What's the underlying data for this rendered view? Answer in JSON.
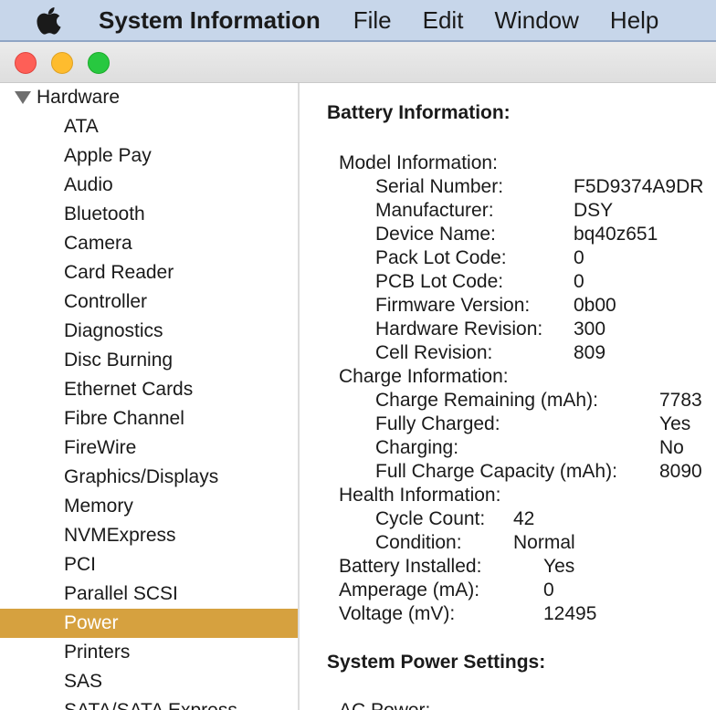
{
  "menubar": {
    "app_name": "System Information",
    "items": [
      "File",
      "Edit",
      "Window",
      "Help"
    ]
  },
  "sidebar": {
    "group_label": "Hardware",
    "items": [
      "ATA",
      "Apple Pay",
      "Audio",
      "Bluetooth",
      "Camera",
      "Card Reader",
      "Controller",
      "Diagnostics",
      "Disc Burning",
      "Ethernet Cards",
      "Fibre Channel",
      "FireWire",
      "Graphics/Displays",
      "Memory",
      "NVMExpress",
      "PCI",
      "Parallel SCSI",
      "Power",
      "Printers",
      "SAS",
      "SATA/SATA Express"
    ],
    "selected": "Power"
  },
  "content": {
    "battery_title": "Battery Information:",
    "model": {
      "heading": "Model Information:",
      "rows": [
        {
          "label": "Serial Number:",
          "value": "F5D9374A9DR"
        },
        {
          "label": "Manufacturer:",
          "value": "DSY"
        },
        {
          "label": "Device Name:",
          "value": "bq40z651"
        },
        {
          "label": "Pack Lot Code:",
          "value": "0"
        },
        {
          "label": "PCB Lot Code:",
          "value": "0"
        },
        {
          "label": "Firmware Version:",
          "value": "0b00"
        },
        {
          "label": "Hardware Revision:",
          "value": "300"
        },
        {
          "label": "Cell Revision:",
          "value": "809"
        }
      ]
    },
    "charge": {
      "heading": "Charge Information:",
      "rows": [
        {
          "label": "Charge Remaining (mAh):",
          "value": "7783"
        },
        {
          "label": "Fully Charged:",
          "value": "Yes"
        },
        {
          "label": "Charging:",
          "value": "No"
        },
        {
          "label": "Full Charge Capacity (mAh):",
          "value": "8090"
        }
      ]
    },
    "health": {
      "heading": "Health Information:",
      "rows": [
        {
          "label": "Cycle Count:",
          "value": "42"
        },
        {
          "label": "Condition:",
          "value": "Normal"
        }
      ]
    },
    "top_rows": [
      {
        "label": "Battery Installed:",
        "value": "Yes"
      },
      {
        "label": "Amperage (mA):",
        "value": "0"
      },
      {
        "label": "Voltage (mV):",
        "value": "12495"
      }
    ],
    "power_title": "System Power Settings:",
    "ac_power_label": "AC Power:"
  }
}
